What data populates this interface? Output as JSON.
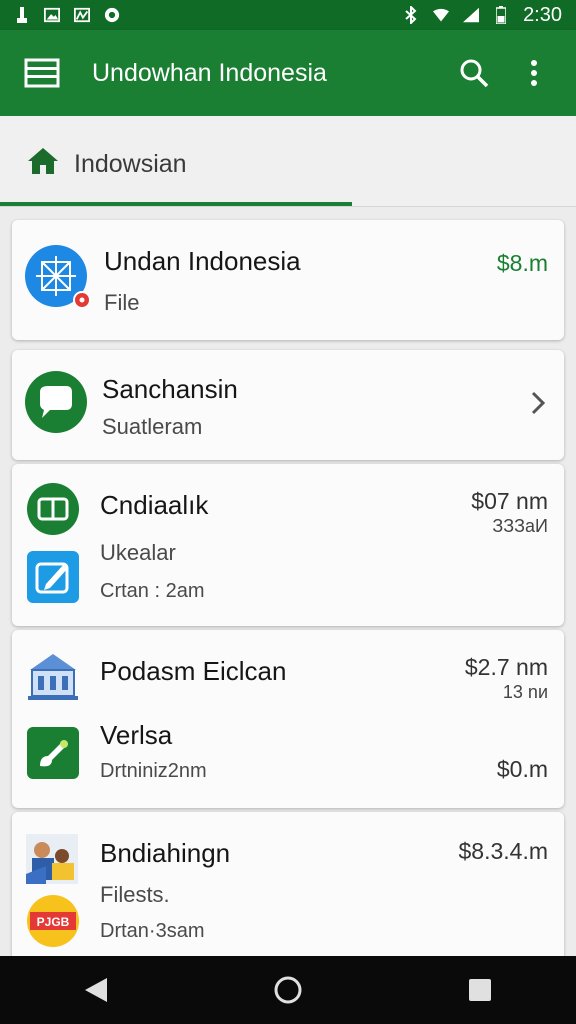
{
  "status_bar": {
    "time": "2:30",
    "left_icons": [
      "usb-icon",
      "image-icon",
      "photo-icon",
      "shield-icon"
    ],
    "right_icons": [
      "bluetooth-icon",
      "wifi-icon",
      "signal-icon",
      "battery-icon"
    ]
  },
  "app_bar": {
    "title": "Undowhan Indonesia",
    "icons": [
      "menu-icon",
      "search-icon",
      "more-vert-icon"
    ]
  },
  "tab": {
    "label": "Indowsian",
    "icon": "home-icon"
  },
  "items": [
    {
      "title": "Undan Indonesia",
      "subtitle": "File",
      "amount": "$8.m"
    },
    {
      "title": "Sanchansin",
      "subtitle": "Suatleram"
    },
    {
      "title": "Cndiaalık",
      "subtitle": "Ukealar",
      "detail": "Crtan : 2am",
      "amount": "$07 nm",
      "amount_sub": "ЗЗЗаИ"
    },
    {
      "title": "Podasm Eiclcan",
      "subtitle": "Verlsa",
      "detail": "Drtniniz2nm",
      "amount": "$2.7 nm",
      "amount_sub": "13 nи",
      "amount2": "$0.m"
    },
    {
      "title": "Bndiahingn",
      "subtitle": "Filests.",
      "detail": "Drtan·3sam",
      "amount": "$8.3.4.m"
    }
  ],
  "nav_bar": [
    "back-icon",
    "home-circle-icon",
    "recents-icon"
  ],
  "colors": {
    "primary": "#1a7f32",
    "status_bar": "#0f6b26",
    "accent_blue": "#1e88e5"
  }
}
